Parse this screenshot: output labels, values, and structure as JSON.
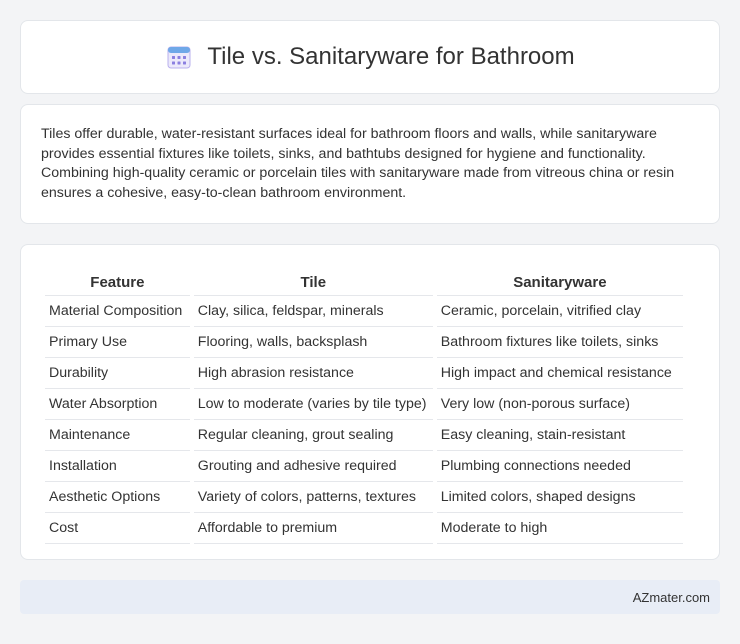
{
  "header": {
    "title": "Tile vs. Sanitaryware for Bathroom",
    "icon": "calendar-icon",
    "icon_color": "#8b7fe0"
  },
  "intro": {
    "text": "Tiles offer durable, water-resistant surfaces ideal for bathroom floors and walls, while sanitaryware provides essential fixtures like toilets, sinks, and bathtubs designed for hygiene and functionality. Combining high-quality ceramic or porcelain tiles with sanitaryware made from vitreous china or resin ensures a cohesive, easy-to-clean bathroom environment."
  },
  "table": {
    "headers": [
      "Feature",
      "Tile",
      "Sanitaryware"
    ],
    "rows": [
      [
        "Material Composition",
        "Clay, silica, feldspar, minerals",
        "Ceramic, porcelain, vitrified clay"
      ],
      [
        "Primary Use",
        "Flooring, walls, backsplash",
        "Bathroom fixtures like toilets, sinks"
      ],
      [
        "Durability",
        "High abrasion resistance",
        "High impact and chemical resistance"
      ],
      [
        "Water Absorption",
        "Low to moderate (varies by tile type)",
        "Very low (non-porous surface)"
      ],
      [
        "Maintenance",
        "Regular cleaning, grout sealing",
        "Easy cleaning, stain-resistant"
      ],
      [
        "Installation",
        "Grouting and adhesive required",
        "Plumbing connections needed"
      ],
      [
        "Aesthetic Options",
        "Variety of colors, patterns, textures",
        "Limited colors, shaped designs"
      ],
      [
        "Cost",
        "Affordable to premium",
        "Moderate to high"
      ]
    ]
  },
  "footer": {
    "brand": "AZmater.com"
  }
}
